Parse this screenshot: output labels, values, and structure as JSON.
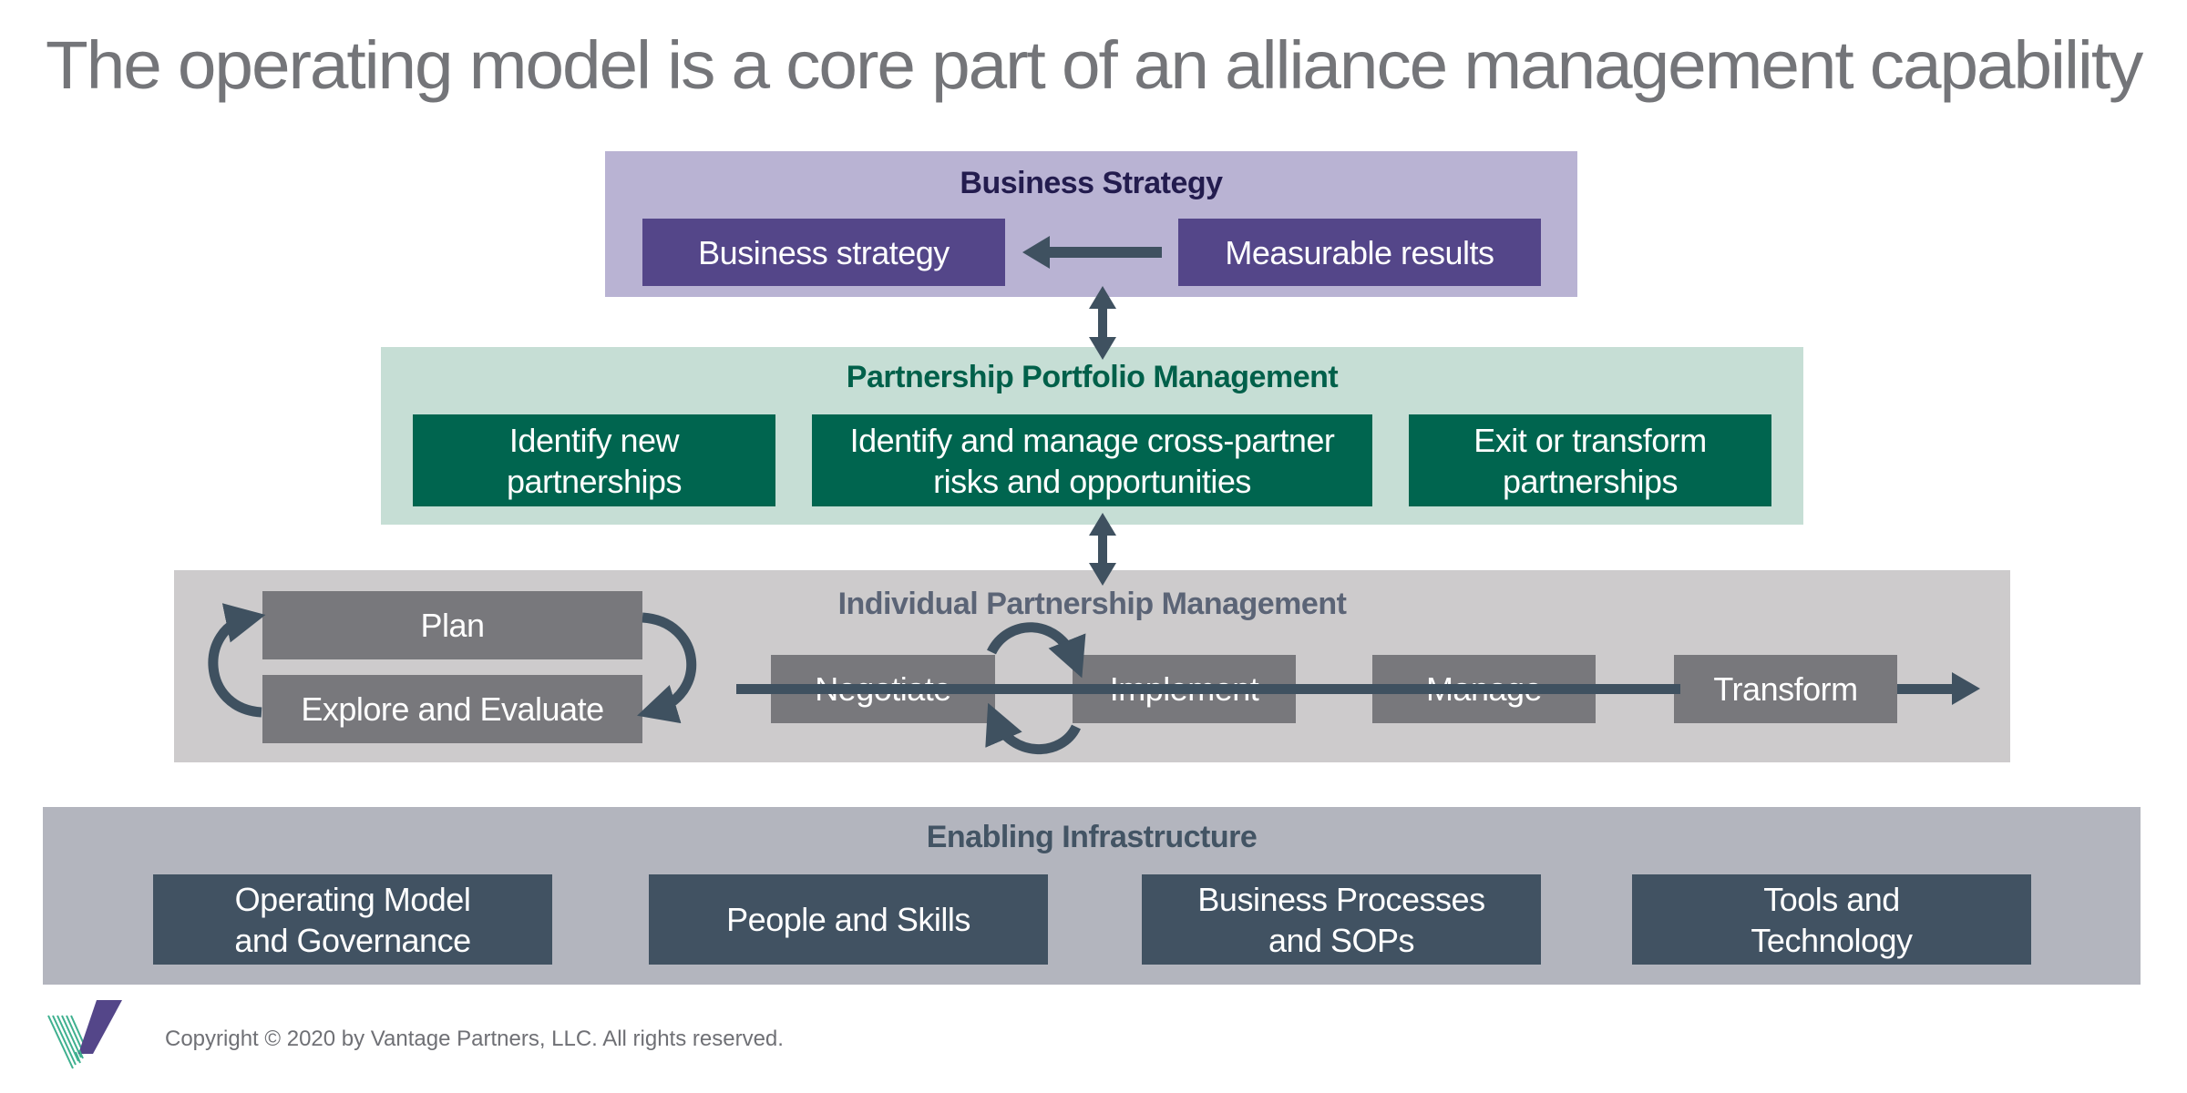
{
  "title": "The operating model is a core part of an alliance management capability",
  "colors": {
    "title": "#747579",
    "connector": "#3F5160",
    "business_strategy_bg": "#B9B3D3",
    "business_strategy_box": "#544689",
    "business_strategy_header": "#231C4E",
    "portfolio_bg": "#C6DED5",
    "portfolio_box": "#00654F",
    "portfolio_header": "#00604A",
    "individual_bg": "#CDCBCC",
    "individual_box": "#78787C",
    "individual_header": "#5B6476",
    "infrastructure_bg": "#B3B5BE",
    "infrastructure_box": "#415262",
    "infrastructure_header": "#435464",
    "logo_purple": "#544689",
    "logo_green": "#3FB08F"
  },
  "business_strategy": {
    "header": "Business Strategy",
    "boxes": [
      "Business strategy",
      "Measurable results"
    ],
    "flow": "Measurable results → Business strategy"
  },
  "portfolio_management": {
    "header": "Partnership Portfolio Management",
    "boxes": [
      "Identify new\npartnerships",
      "Identify and manage cross-partner\nrisks and opportunities",
      "Exit or transform\npartnerships"
    ]
  },
  "individual_management": {
    "header": "Individual Partnership Management",
    "cycle": [
      "Plan",
      "Explore and Evaluate"
    ],
    "stages": [
      "Negotiate",
      "Implement",
      "Manage",
      "Transform"
    ]
  },
  "infrastructure": {
    "header": "Enabling Infrastructure",
    "boxes": [
      "Operating Model\nand Governance",
      "People and Skills",
      "Business Processes\nand SOPs",
      "Tools and\nTechnology"
    ]
  },
  "footer": {
    "logo": "vantage-partners-v-logo",
    "copyright": "Copyright © 2020 by Vantage Partners, LLC. All rights reserved."
  }
}
